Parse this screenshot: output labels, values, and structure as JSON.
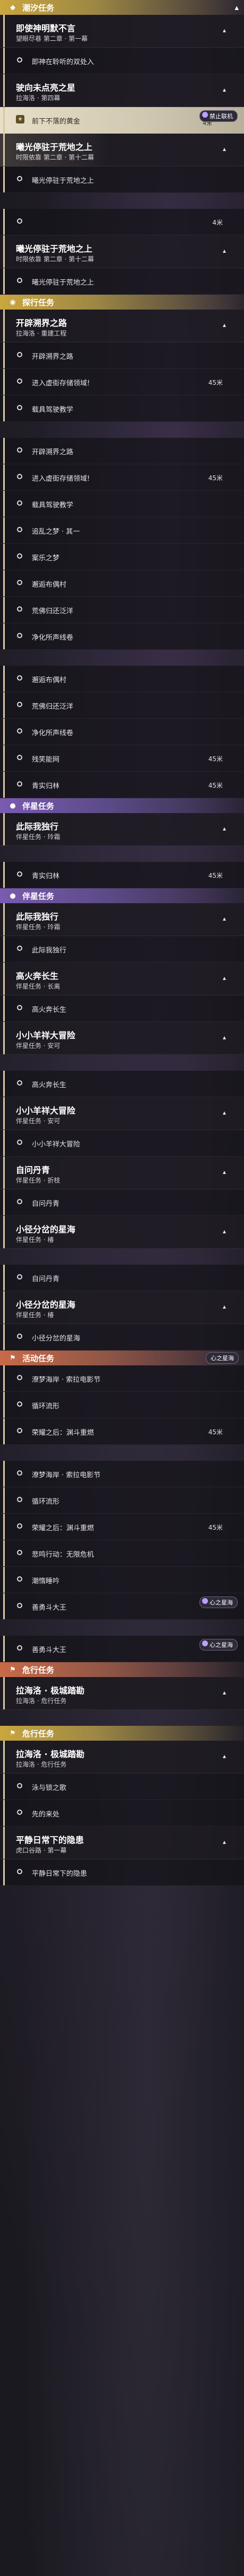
{
  "rows": [
    {
      "kind": "sec",
      "color": "yellow",
      "icon": "bookmark-icon",
      "label": "潮汐任务",
      "chev": "▴"
    },
    {
      "kind": "mh",
      "title": "即使神明默不言",
      "sub": "望眼尽巷 第二章 · 第一幕",
      "chev": "▴",
      "sel": false
    },
    {
      "kind": "obj",
      "text": "即神在聆听的双处入",
      "dist": ""
    },
    {
      "kind": "mh",
      "title": "驶向未点亮之星",
      "sub": "拉海洛 · 第四幕",
      "chev": "▴",
      "sel": false
    },
    {
      "kind": "obj",
      "active": true,
      "star": true,
      "text": "前下不落的黄金",
      "dist": "4米",
      "tag": "禁止联机"
    },
    {
      "kind": "mh",
      "title": "曦光停驻于荒地之上",
      "sub": "时限依靠 第二章 · 第十二幕",
      "chev": "▴",
      "sel": true
    },
    {
      "kind": "obj",
      "text": "曦光停驻于荒地之上",
      "dist": ""
    },
    {
      "kind": "gap"
    },
    {
      "kind": "obj",
      "text": "",
      "dist": "4米"
    },
    {
      "kind": "mh",
      "title": "曦光停驻于荒地之上",
      "sub": "时限依靠 第二章 · 第十二幕",
      "chev": "▴",
      "sel": false
    },
    {
      "kind": "obj",
      "text": "曦光停驻于荒地之上",
      "dist": ""
    },
    {
      "kind": "sec",
      "color": "yellow",
      "icon": "location-icon",
      "label": "探行任务",
      "chev": ""
    },
    {
      "kind": "mh",
      "title": "开辟溯界之路",
      "sub": "拉海洛 · 重建工程",
      "chev": "▴",
      "sel": false
    },
    {
      "kind": "obj",
      "text": "开辟溯界之路",
      "dist": ""
    },
    {
      "kind": "obj",
      "text": "进入虚街存储领域!",
      "dist": "45米"
    },
    {
      "kind": "obj",
      "text": "载具驾驶教学",
      "dist": ""
    },
    {
      "kind": "gap"
    },
    {
      "kind": "obj",
      "text": "开辟溯界之路",
      "dist": ""
    },
    {
      "kind": "obj",
      "text": "进入虚街存储领域!",
      "dist": "45米"
    },
    {
      "kind": "obj",
      "text": "载具驾驶教学",
      "dist": ""
    },
    {
      "kind": "obj",
      "text": "追乱之梦 · 其一",
      "dist": ""
    },
    {
      "kind": "obj",
      "text": "案乐之梦",
      "dist": ""
    },
    {
      "kind": "obj",
      "text": "邂逅布偶村",
      "dist": ""
    },
    {
      "kind": "obj",
      "text": "荒佛归还泛洋",
      "dist": ""
    },
    {
      "kind": "obj",
      "text": "净化所声线卷",
      "dist": ""
    },
    {
      "kind": "gap"
    },
    {
      "kind": "obj",
      "text": "邂逅布偶村",
      "dist": ""
    },
    {
      "kind": "obj",
      "text": "荒佛归还泛洋",
      "dist": ""
    },
    {
      "kind": "obj",
      "text": "净化所声线卷",
      "dist": ""
    },
    {
      "kind": "obj",
      "text": "残笑能网",
      "dist": "45米"
    },
    {
      "kind": "obj",
      "text": "青实归林",
      "dist": "45米"
    },
    {
      "kind": "sec",
      "color": "purple",
      "icon": "person-icon",
      "label": "伴星任务",
      "chev": ""
    },
    {
      "kind": "mh",
      "title": "此际我独行",
      "sub": "伴星任务 · 玲霜",
      "chev": "▴",
      "sel": false
    },
    {
      "kind": "gap"
    },
    {
      "kind": "obj",
      "text": "青实归林",
      "dist": "45米"
    },
    {
      "kind": "sec",
      "color": "purple",
      "icon": "person-icon",
      "label": "伴星任务",
      "chev": ""
    },
    {
      "kind": "mh",
      "title": "此际我独行",
      "sub": "伴星任务 · 玲霜",
      "chev": "▴",
      "sel": false
    },
    {
      "kind": "obj",
      "text": "此际我独行",
      "dist": ""
    },
    {
      "kind": "mh",
      "title": "高火奔长生",
      "sub": "伴星任务 · 长离",
      "chev": "▴",
      "sel": false
    },
    {
      "kind": "obj",
      "text": "高火奔长生",
      "dist": ""
    },
    {
      "kind": "mh",
      "title": "小小羊祥大冒险",
      "sub": "伴星任务 · 安可",
      "chev": "▴",
      "sel": false
    },
    {
      "kind": "gap"
    },
    {
      "kind": "obj",
      "text": "高火奔长生",
      "dist": ""
    },
    {
      "kind": "mh",
      "title": "小小羊祥大冒险",
      "sub": "伴星任务 · 安可",
      "chev": "▴",
      "sel": false
    },
    {
      "kind": "obj",
      "text": "小小羊祥大冒险",
      "dist": ""
    },
    {
      "kind": "mh",
      "title": "自问丹青",
      "sub": "伴星任务 · 折枝",
      "chev": "▴",
      "sel": false
    },
    {
      "kind": "obj",
      "text": "自问丹青",
      "dist": ""
    },
    {
      "kind": "mh",
      "title": "小径分岔的星海",
      "sub": "伴星任务 · 椿",
      "chev": "▴",
      "sel": false
    },
    {
      "kind": "gap"
    },
    {
      "kind": "obj",
      "text": "自问丹青",
      "dist": ""
    },
    {
      "kind": "mh",
      "title": "小径分岔的星海",
      "sub": "伴星任务 · 椿",
      "chev": "▴",
      "sel": false
    },
    {
      "kind": "obj",
      "text": "小径分岔的星海",
      "dist": ""
    },
    {
      "kind": "sec",
      "color": "orange",
      "icon": "flag-icon",
      "label": "活动任务",
      "chev": "",
      "tag": "心之星海"
    },
    {
      "kind": "obj",
      "text": "潦梦海岸 · 索拉电影节",
      "dist": ""
    },
    {
      "kind": "obj",
      "text": "循环流形",
      "dist": ""
    },
    {
      "kind": "obj",
      "text": "荣耀之后：渊斗重燃",
      "dist": "45米"
    },
    {
      "kind": "gap"
    },
    {
      "kind": "obj",
      "text": "潦梦海岸 · 索拉电影节",
      "dist": ""
    },
    {
      "kind": "obj",
      "text": "循环流形",
      "dist": ""
    },
    {
      "kind": "obj",
      "text": "荣耀之后：渊斗重燃",
      "dist": "45米"
    },
    {
      "kind": "obj",
      "text": "悲鸣行动：无限危机",
      "dist": ""
    },
    {
      "kind": "obj",
      "text": "潮惰睡吟",
      "dist": ""
    },
    {
      "kind": "obj",
      "text": "善勇斗大王",
      "dist": "",
      "tag": "心之星海"
    },
    {
      "kind": "gap"
    },
    {
      "kind": "obj",
      "text": "善勇斗大王",
      "dist": "",
      "tag": "心之星海"
    },
    {
      "kind": "sec",
      "color": "orange",
      "icon": "flag-icon",
      "label": "危行任务",
      "chev": ""
    },
    {
      "kind": "mh",
      "title": "拉海洛 · 极城踏勘",
      "sub": "拉海洛 · 危行任务",
      "chev": "▴",
      "sel": false
    },
    {
      "kind": "gap"
    },
    {
      "kind": "sec",
      "color": "yellow",
      "icon": "flag-icon",
      "label": "危行任务",
      "chev": ""
    },
    {
      "kind": "mh",
      "title": "拉海洛 · 极城踏勘",
      "sub": "拉海洛 · 危行任务",
      "chev": "▴",
      "sel": false
    },
    {
      "kind": "obj",
      "text": "泳与锁之歌",
      "dist": ""
    },
    {
      "kind": "obj",
      "text": "先的来处",
      "dist": ""
    },
    {
      "kind": "mh",
      "title": "平静日常下的隐患",
      "sub": "虎口谷路 · 第一幕",
      "chev": "▴",
      "sel": false
    },
    {
      "kind": "obj",
      "text": "平静日常下的隐患",
      "dist": ""
    }
  ]
}
